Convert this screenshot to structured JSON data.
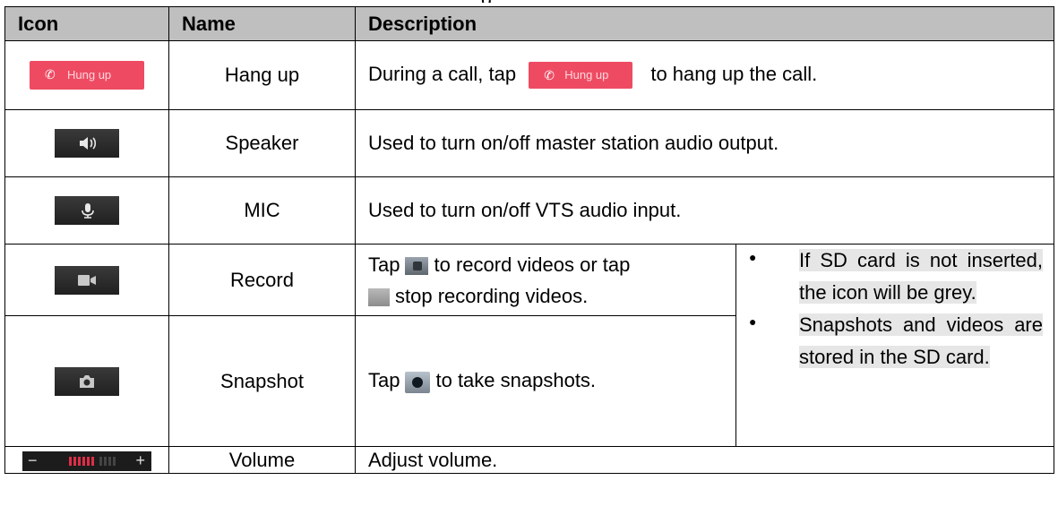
{
  "top_fragment": "g",
  "headers": {
    "icon": "Icon",
    "name": "Name",
    "description": "Description"
  },
  "rows": {
    "hangup": {
      "icon_label": "Hung up",
      "icon": "phone-hangup-icon",
      "name": "Hang up",
      "desc_before": "During a call, tap",
      "desc_after": "to hang up the call.",
      "inline_label": "Hung up"
    },
    "speaker": {
      "icon": "speaker-icon",
      "name": "Speaker",
      "desc": "Used to turn on/off master station audio output."
    },
    "mic": {
      "icon": "microphone-icon",
      "name": "MIC",
      "desc": "Used to turn on/off VTS audio input."
    },
    "record": {
      "icon": "video-camera-icon",
      "name": "Record",
      "desc_part1": "Tap",
      "desc_part2": "to record videos or tap",
      "desc_part3": "stop recording videos."
    },
    "snapshot": {
      "icon": "camera-icon",
      "name": "Snapshot",
      "desc_part1": "Tap",
      "desc_part2": "to take snapshots."
    },
    "volume": {
      "icon": "volume-slider-icon",
      "name": "Volume",
      "desc": "Adjust volume.",
      "minus": "−",
      "plus": "+"
    }
  },
  "notes": [
    "If SD card is not inserted, the icon will be grey.",
    "Snapshots and videos are stored in the SD card."
  ],
  "colors": {
    "header_bg": "#bfbfbf",
    "hangup_red": "#ee4b63",
    "volume_red": "#e02d47",
    "icon_dark": "#2a2a2a"
  }
}
